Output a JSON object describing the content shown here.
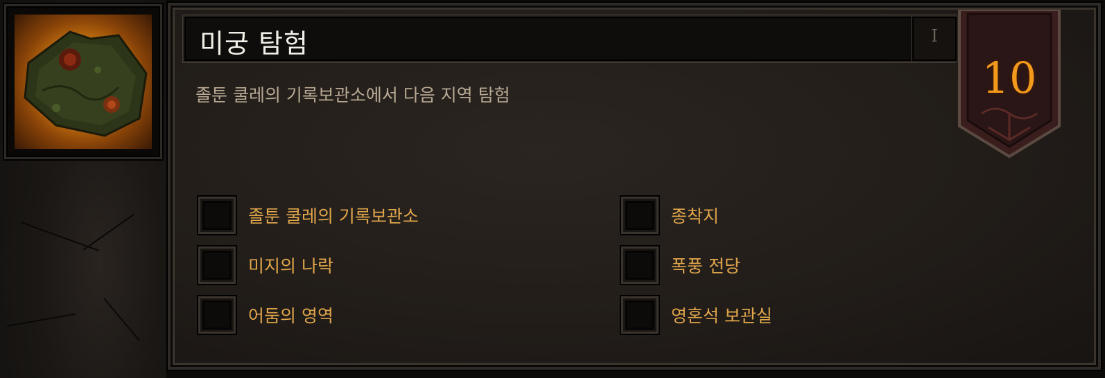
{
  "achievement": {
    "title": "미궁 탐험",
    "tier_roman": "I",
    "description": "졸툰 쿨레의 기록보관소에서 다음 지역 탐험",
    "points": "10",
    "objectives": [
      {
        "label": "졸툰 쿨레의 기록보관소",
        "completed": false
      },
      {
        "label": "미지의 나락",
        "completed": false
      },
      {
        "label": "어둠의 영역",
        "completed": false
      },
      {
        "label": "종착지",
        "completed": false
      },
      {
        "label": "폭풍 전당",
        "completed": false
      },
      {
        "label": "영혼석 보관실",
        "completed": false
      }
    ]
  },
  "icon": {
    "name": "map-icon"
  },
  "colors": {
    "title": "#f2efe8",
    "description": "#b8aa94",
    "objective": "#e0a64c",
    "points": "#f39a1c"
  }
}
